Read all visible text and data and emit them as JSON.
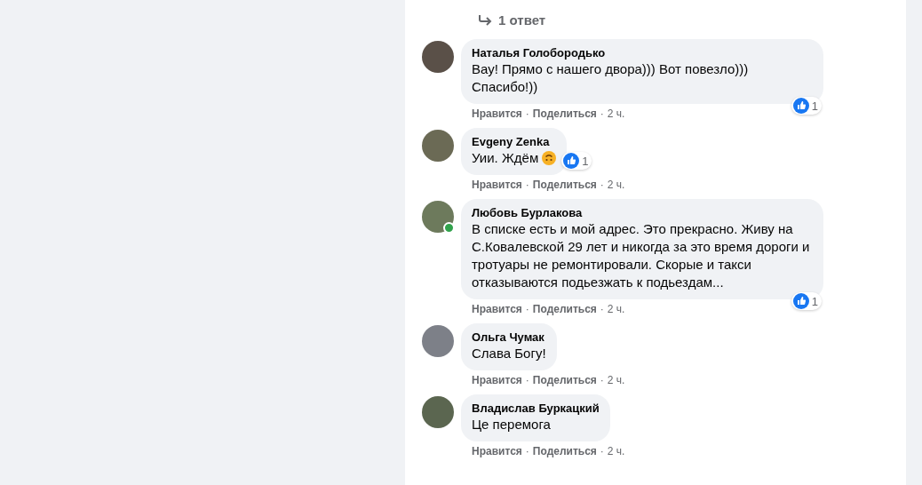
{
  "replies_link": {
    "label": "1 ответ"
  },
  "comments": [
    {
      "author": "Наталья Голобородько",
      "text": "Вау! Прямо с нашего двора))) Вот повезло))) Спасибо!))",
      "online": false,
      "emoji": false,
      "reactions": "1",
      "actions": [
        "Нравится",
        "Поделиться"
      ],
      "separator": "·",
      "time": "2 ч."
    },
    {
      "author": "Evgeny Zenka",
      "text": "Уии. Ждём",
      "online": false,
      "emoji": true,
      "reactions": "1",
      "actions": [
        "Нравится",
        "Поделиться"
      ],
      "separator": "·",
      "time": "2 ч."
    },
    {
      "author": "Любовь Бурлакова",
      "text": "В списке есть и мой адрес. Это прекрасно. Живу на С.Ковалевской 29 лет и никогда за это время дороги и тротуары не ремонтировали. Скорые и такси отказываются подьезжать к подьездам...",
      "online": true,
      "emoji": false,
      "reactions": "1",
      "actions": [
        "Нравится",
        "Поделиться"
      ],
      "separator": "·",
      "time": "2 ч."
    },
    {
      "author": "Ольга Чумак",
      "text": "Слава Богу!",
      "online": false,
      "emoji": false,
      "actions": [
        "Нравится",
        "Поделиться"
      ],
      "separator": "·",
      "time": "2 ч."
    },
    {
      "author": "Владислав Буркацкий",
      "text": "Це перемога",
      "online": false,
      "emoji": false,
      "actions": [
        "Нравится",
        "Поделиться"
      ],
      "separator": "·",
      "time": "2 ч."
    }
  ]
}
